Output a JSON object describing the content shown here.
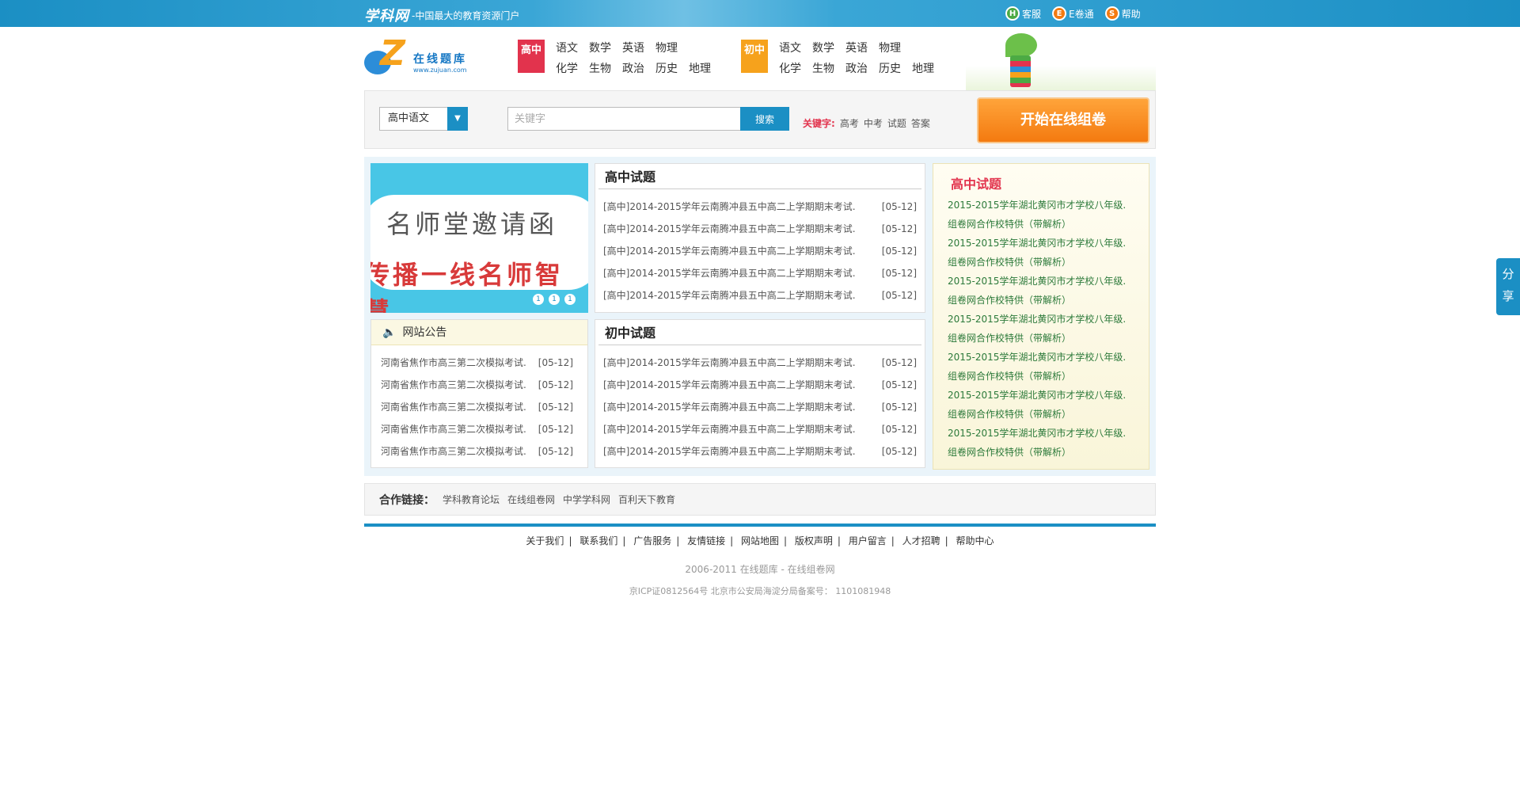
{
  "topbar": {
    "brand": "学科网",
    "slogan": "-中国最大的教育资源门户",
    "nav": [
      {
        "icon": "H",
        "label": "客服",
        "color": "#4caa44"
      },
      {
        "icon": "E",
        "label": "E卷通",
        "color": "#f47a10"
      },
      {
        "icon": "S",
        "label": "帮助",
        "color": "#f47a10"
      }
    ]
  },
  "header": {
    "logo_title": "在线题库",
    "logo_url": "www.zujuan.com",
    "senior_tag": "高中",
    "junior_tag": "初中",
    "senior_subjects": [
      "语文",
      "数学",
      "英语",
      "物理",
      "",
      "化学",
      "生物",
      "政治",
      "历史",
      "地理"
    ],
    "junior_subjects": [
      "语文",
      "数学",
      "英语",
      "物理",
      "",
      "化学",
      "生物",
      "政治",
      "历史",
      "地理"
    ]
  },
  "search": {
    "select_value": "高中语文",
    "placeholder": "关键字",
    "button": "搜索",
    "hot_label": "关键字:",
    "hot_words": [
      "高考",
      "中考",
      "试题",
      "答案"
    ],
    "start_button": "开始在线组卷"
  },
  "banner": {
    "line1": "名师堂邀请函",
    "line2": "传播一线名师智慧",
    "dots": [
      "1",
      "1",
      "1"
    ]
  },
  "notice": {
    "title": "网站公告",
    "items": [
      {
        "text": "河南省焦作市高三第二次模拟考试.",
        "date": "[05-12]"
      },
      {
        "text": "河南省焦作市高三第二次模拟考试.",
        "date": "[05-12]"
      },
      {
        "text": "河南省焦作市高三第二次模拟考试.",
        "date": "[05-12]"
      },
      {
        "text": "河南省焦作市高三第二次模拟考试.",
        "date": "[05-12]"
      },
      {
        "text": "河南省焦作市高三第二次模拟考试.",
        "date": "[05-12]"
      }
    ]
  },
  "senior_exams": {
    "title": "高中试题",
    "items": [
      {
        "text": "[高中]2014-2015学年云南腾冲县五中高二上学期期末考试.",
        "date": "[05-12]"
      },
      {
        "text": "[高中]2014-2015学年云南腾冲县五中高二上学期期末考试.",
        "date": "[05-12]"
      },
      {
        "text": "[高中]2014-2015学年云南腾冲县五中高二上学期期末考试.",
        "date": "[05-12]"
      },
      {
        "text": "[高中]2014-2015学年云南腾冲县五中高二上学期期末考试.",
        "date": "[05-12]"
      },
      {
        "text": "[高中]2014-2015学年云南腾冲县五中高二上学期期末考试.",
        "date": "[05-12]"
      }
    ]
  },
  "junior_exams": {
    "title": "初中试题",
    "items": [
      {
        "text": "[高中]2014-2015学年云南腾冲县五中高二上学期期末考试.",
        "date": "[05-12]"
      },
      {
        "text": "[高中]2014-2015学年云南腾冲县五中高二上学期期末考试.",
        "date": "[05-12]"
      },
      {
        "text": "[高中]2014-2015学年云南腾冲县五中高二上学期期末考试.",
        "date": "[05-12]"
      },
      {
        "text": "[高中]2014-2015学年云南腾冲县五中高二上学期期末考试.",
        "date": "[05-12]"
      },
      {
        "text": "[高中]2014-2015学年云南腾冲县五中高二上学期期末考试.",
        "date": "[05-12]"
      }
    ]
  },
  "side": {
    "title": "高中试题",
    "items": [
      "2015-2015学年湖北黄冈市才学校八年级.",
      "组卷网合作校特供（带解析）",
      "2015-2015学年湖北黄冈市才学校八年级.",
      "组卷网合作校特供（带解析）",
      "2015-2015学年湖北黄冈市才学校八年级.",
      "组卷网合作校特供（带解析）",
      "2015-2015学年湖北黄冈市才学校八年级.",
      "组卷网合作校特供（带解析）",
      "2015-2015学年湖北黄冈市才学校八年级.",
      "组卷网合作校特供（带解析）",
      "2015-2015学年湖北黄冈市才学校八年级.",
      "组卷网合作校特供（带解析）",
      "2015-2015学年湖北黄冈市才学校八年级.",
      "组卷网合作校特供（带解析）"
    ]
  },
  "partners": {
    "label": "合作链接：",
    "links": [
      "学科教育论坛",
      "在线组卷网",
      "中学学科网",
      "百利天下教育"
    ]
  },
  "footer": {
    "links": [
      "关于我们",
      "联系我们",
      "广告服务",
      "友情链接",
      "网站地图",
      "版权声明",
      "用户留言",
      "人才招聘",
      "帮助中心"
    ],
    "copyright": "2006-2011 在线题库 - 在线组卷网",
    "icp": "京ICP证0812564号 北京市公安局海淀分局备案号： 1101081948"
  },
  "share": {
    "line1": "分",
    "line2": "享"
  },
  "colors": {
    "primary": "#1b8fc4",
    "accent_red": "#e2334d",
    "accent_orange": "#f47a10"
  }
}
